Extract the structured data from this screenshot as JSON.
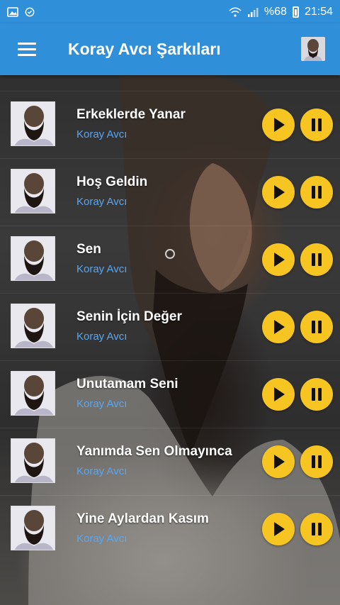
{
  "status_bar": {
    "battery": "%68",
    "time": "21:54",
    "icons": [
      "gallery-icon",
      "shield-check-icon",
      "wifi-icon",
      "signal-icon",
      "battery-icon"
    ]
  },
  "app_bar": {
    "title": "Koray Avcı Şarkıları",
    "menu_icon": "hamburger-menu-icon",
    "avatar": "artist-avatar"
  },
  "colors": {
    "primary": "#2f8fd8",
    "button": "#f6c521",
    "artist_text": "#5aa6f0"
  },
  "songs": [
    {
      "title": "Erkeklerde Yanar",
      "artist": "Koray Avcı"
    },
    {
      "title": "Hoş Geldin",
      "artist": "Koray Avcı"
    },
    {
      "title": "Sen",
      "artist": "Koray Avcı"
    },
    {
      "title": "Senin İçin Değer",
      "artist": "Koray Avcı"
    },
    {
      "title": "Unutamam Seni",
      "artist": "Koray Avcı"
    },
    {
      "title": "Yanımda Sen Olmayınca",
      "artist": "Koray Avcı"
    },
    {
      "title": "Yine Aylardan Kasım",
      "artist": "Koray Avcı"
    }
  ]
}
